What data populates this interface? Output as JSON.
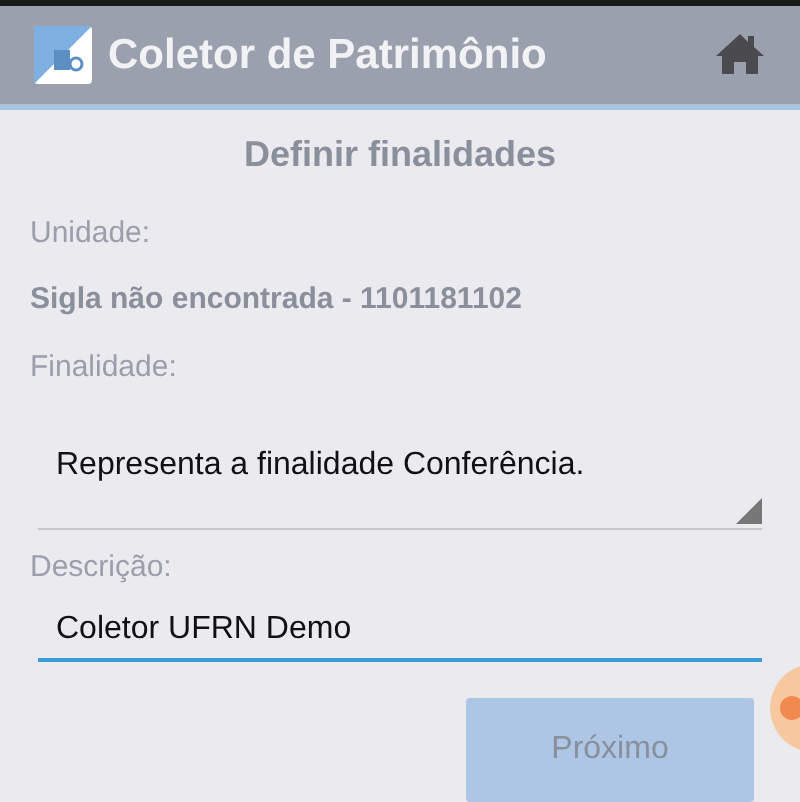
{
  "app_bar": {
    "title": "Coletor de Patrimônio"
  },
  "page_title": "Definir finalidades",
  "unit": {
    "label": "Unidade:",
    "value": "Sigla não encontrada - 1101181102"
  },
  "purpose": {
    "label": "Finalidade:",
    "value": "Representa a finalidade Conferência."
  },
  "description": {
    "label": "Descrição:",
    "value": "Coletor UFRN Demo",
    "focused": true
  },
  "next_button": {
    "label": "Próximo",
    "disabled": true
  }
}
